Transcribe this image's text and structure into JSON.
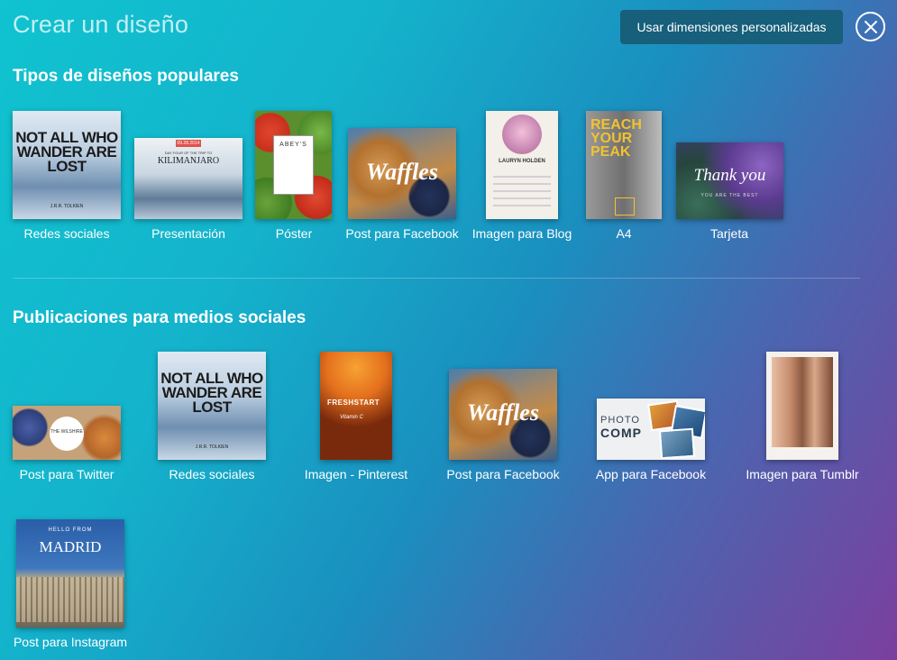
{
  "header": {
    "title": "Crear un diseño",
    "custom_button": "Usar dimensiones personalizadas"
  },
  "sections": {
    "popular": {
      "title": "Tipos de diseños populares",
      "items": [
        {
          "label": "Redes sociales"
        },
        {
          "label": "Presentación"
        },
        {
          "label": "Póster"
        },
        {
          "label": "Post para Facebook"
        },
        {
          "label": "Imagen para Blog"
        },
        {
          "label": "A4"
        },
        {
          "label": "Tarjeta"
        }
      ]
    },
    "social": {
      "title": "Publicaciones para medios sociales",
      "items": [
        {
          "label": "Post para Twitter"
        },
        {
          "label": "Redes sociales"
        },
        {
          "label": "Imagen - Pinterest"
        },
        {
          "label": "Post para Facebook"
        },
        {
          "label": "App para Facebook"
        },
        {
          "label": "Imagen para Tumblr"
        },
        {
          "label": "Post para Instagram"
        }
      ]
    }
  },
  "thumb_text": {
    "quote": "NOT ALL WHO WANDER ARE LOST",
    "quote_author": "J.R.R. TOLKIEN",
    "kili_date": "09.28.2014",
    "kili_sub": "DAY FOUR OF THE TRIP TO",
    "kili_title": "KILIMANJARO",
    "poster_title": "ABEY'S",
    "waffles": "Waffles",
    "blog_name": "LAURYN HOLDEN",
    "a4_text": "REACH YOUR PEAK",
    "thanks": "Thank you",
    "thanks_sub": "YOU ARE THE BEST",
    "wilshire": "THE WILSHIRE",
    "freshstart": "FRESHSTART",
    "vitamin": "Vitamin C",
    "photo": "PHOTO",
    "comp": "COMP",
    "madrid_hello": "HELLO FROM",
    "madrid": "MADRID"
  }
}
